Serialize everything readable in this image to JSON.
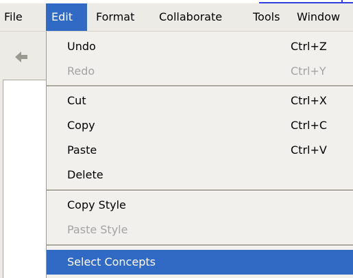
{
  "menubar": {
    "items": [
      {
        "id": "file",
        "label": "File"
      },
      {
        "id": "edit",
        "label": "Edit"
      },
      {
        "id": "format",
        "label": "Format"
      },
      {
        "id": "collaborate",
        "label": "Collaborate"
      },
      {
        "id": "tools",
        "label": "Tools"
      },
      {
        "id": "window",
        "label": "Window"
      }
    ],
    "active": "Edit"
  },
  "toolbar": {
    "back_icon": "back-arrow-icon"
  },
  "edit_menu": {
    "items": [
      {
        "label": "Undo",
        "shortcut": "Ctrl+Z",
        "enabled": true
      },
      {
        "label": "Redo",
        "shortcut": "Ctrl+Y",
        "enabled": false
      },
      {
        "label": "Cut",
        "shortcut": "Ctrl+X",
        "enabled": true
      },
      {
        "label": "Copy",
        "shortcut": "Ctrl+C",
        "enabled": true
      },
      {
        "label": "Paste",
        "shortcut": "Ctrl+V",
        "enabled": true
      },
      {
        "label": "Delete",
        "shortcut": "",
        "enabled": true
      },
      {
        "label": "Copy Style",
        "shortcut": "",
        "enabled": true
      },
      {
        "label": "Paste Style",
        "shortcut": "",
        "enabled": false
      },
      {
        "label": "Select Concepts",
        "shortcut": "",
        "enabled": true,
        "highlighted": true
      }
    ]
  },
  "colors": {
    "highlight": "#316ac5",
    "menu_background": "#f1f0ec",
    "disabled_text": "#a3a3a3",
    "link_blue": "#2f3fe0"
  }
}
